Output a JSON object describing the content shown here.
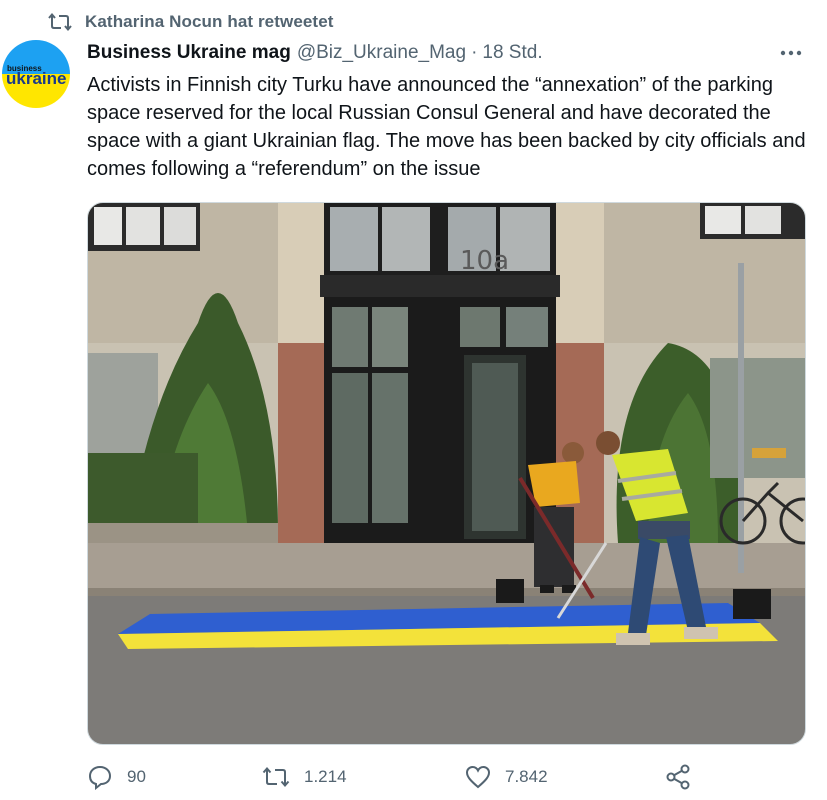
{
  "social_context": {
    "text": "Katharina Nocun hat retweetet",
    "icon": "retweet-icon"
  },
  "author": {
    "display_name": "Business Ukraine mag",
    "handle": "@Biz_Ukraine_Mag",
    "separator": "·",
    "time": "18 Std.",
    "avatar": {
      "logo_top": "business",
      "logo_main": "ukraine",
      "top_color": "#1da1f2",
      "bottom_color": "#ffe600"
    }
  },
  "more_icon": "more-horizontal-icon",
  "tweet": {
    "text": "Activists in Finnish city Turku have announced the “annexation” of the parking space reserved for the local Russian Consul General and have decorated the space with a giant Ukrainian flag. The move has been backed by city officials  and comes following a “referendum” on the issue"
  },
  "media": {
    "building_number": "10a"
  },
  "actions": {
    "reply": {
      "icon": "reply-icon",
      "count": "90"
    },
    "retweet": {
      "icon": "retweet-icon",
      "count": "1.214"
    },
    "like": {
      "icon": "heart-icon",
      "count": "7.842"
    },
    "share": {
      "icon": "share-icon"
    }
  },
  "colors": {
    "text_primary": "#0f1419",
    "text_secondary": "#536471",
    "flag_blue": "#2f5fd0",
    "flag_yellow": "#f3e23a"
  }
}
